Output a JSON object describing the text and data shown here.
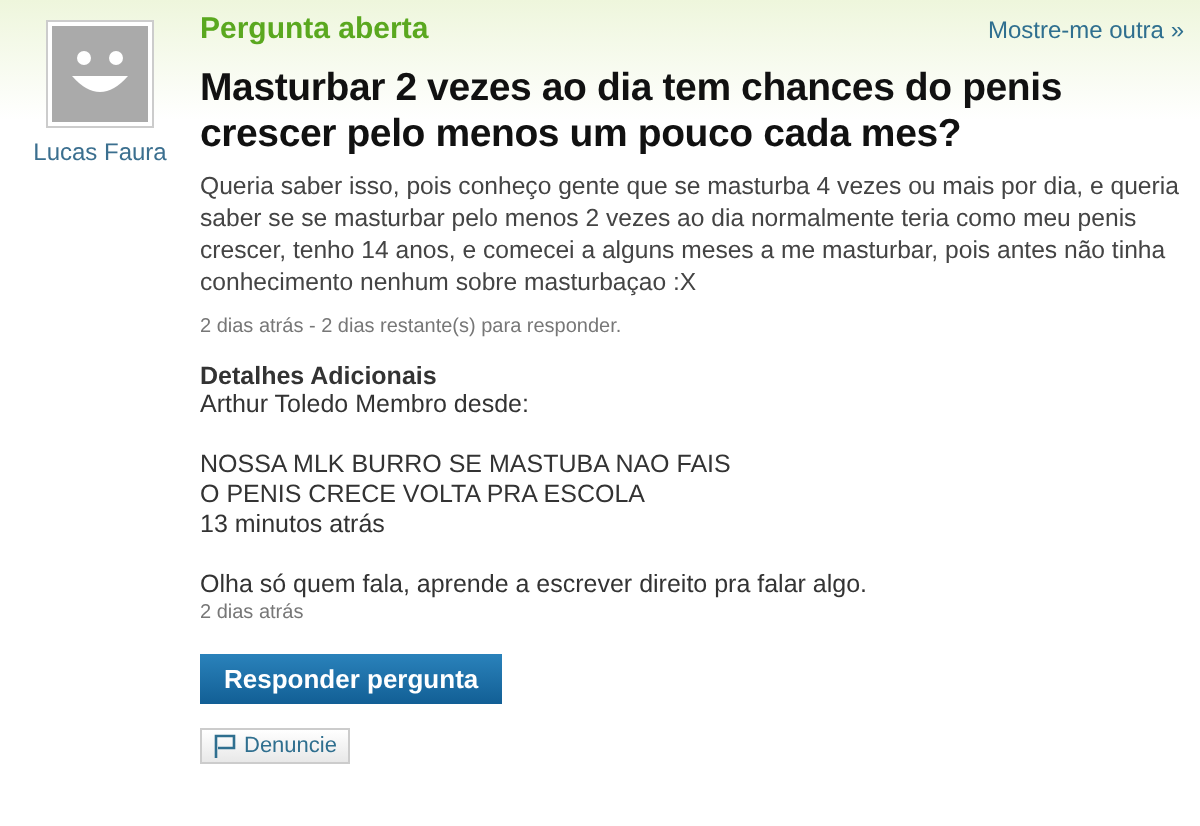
{
  "asker": {
    "name": "Lucas Faura"
  },
  "status": "Pergunta aberta",
  "next_link": "Mostre-me outra »",
  "question": {
    "title": "Masturbar 2 vezes ao dia tem chances do penis crescer pelo menos um pouco cada mes?",
    "body": "Queria saber isso, pois conheço gente que se masturba 4 vezes ou mais por dia, e queria saber se se masturbar pelo menos 2 vezes ao dia normalmente teria como meu penis crescer, tenho 14 anos, e comecei a alguns meses a me masturbar, pois antes não tinha conhecimento nenhum sobre masturbaçao :X",
    "meta": "2 dias atrás - 2 dias restante(s) para responder."
  },
  "details": {
    "heading": "Detalhes Adicionais",
    "blocks": [
      [
        {
          "kind": "text",
          "text": "Arthur Toledo Membro desde:"
        }
      ],
      [
        {
          "kind": "text",
          "text": "NOSSA MLK BURRO SE MASTUBA NAO FAIS"
        },
        {
          "kind": "text",
          "text": "O PENIS CRECE VOLTA PRA ESCOLA"
        },
        {
          "kind": "text",
          "text": "13 minutos atrás"
        }
      ],
      [
        {
          "kind": "text",
          "text": "Olha só quem fala, aprende a escrever direito pra falar algo."
        },
        {
          "kind": "time",
          "text": "2 dias atrás"
        }
      ]
    ]
  },
  "answer_button": "Responder pergunta",
  "report_button": "Denuncie"
}
